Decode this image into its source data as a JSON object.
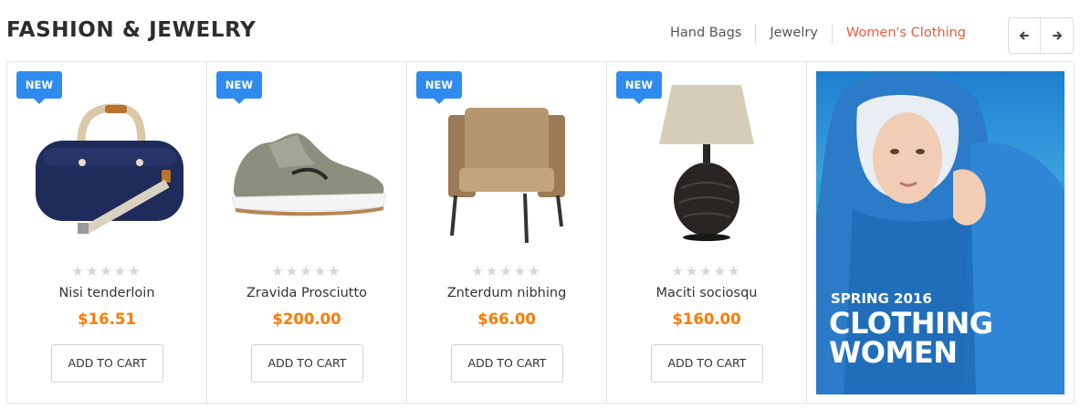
{
  "section": {
    "title": "FASHION & JEWELRY",
    "tabs": [
      {
        "label": "Hand Bags"
      },
      {
        "label": "Jewelry"
      },
      {
        "label": "Women's Clothing"
      }
    ],
    "active_tab": "Women's Clothing",
    "nav": {
      "prev_icon": "arrow-left-icon",
      "next_icon": "arrow-right-icon"
    }
  },
  "products": [
    {
      "badge": "NEW",
      "image": "duffel-bag",
      "rating": 0,
      "max_rating": 5,
      "name": "Nisi tenderloin",
      "price": "$16.51",
      "button": "ADD TO CART"
    },
    {
      "badge": "NEW",
      "image": "sneaker",
      "rating": 0,
      "max_rating": 5,
      "name": "Zravida Prosciutto",
      "price": "$200.00",
      "button": "ADD TO CART"
    },
    {
      "badge": "NEW",
      "image": "armchair",
      "rating": 0,
      "max_rating": 5,
      "name": "Znterdum nibhing",
      "price": "$66.00",
      "button": "ADD TO CART"
    },
    {
      "badge": "NEW",
      "image": "table-lamp",
      "rating": 0,
      "max_rating": 5,
      "name": "Maciti sociosqu",
      "price": "$160.00",
      "button": "ADD TO CART"
    }
  ],
  "banner": {
    "subtitle": "SPRING 2016",
    "headline_line1": "CLOTHING",
    "headline_line2": "WOMEN",
    "image": "woman-in-blue-hooded-jacket"
  },
  "colors": {
    "accent_tab": "#ef5a3e",
    "price": "#ff7a00",
    "badge": "#2f8bf0"
  }
}
